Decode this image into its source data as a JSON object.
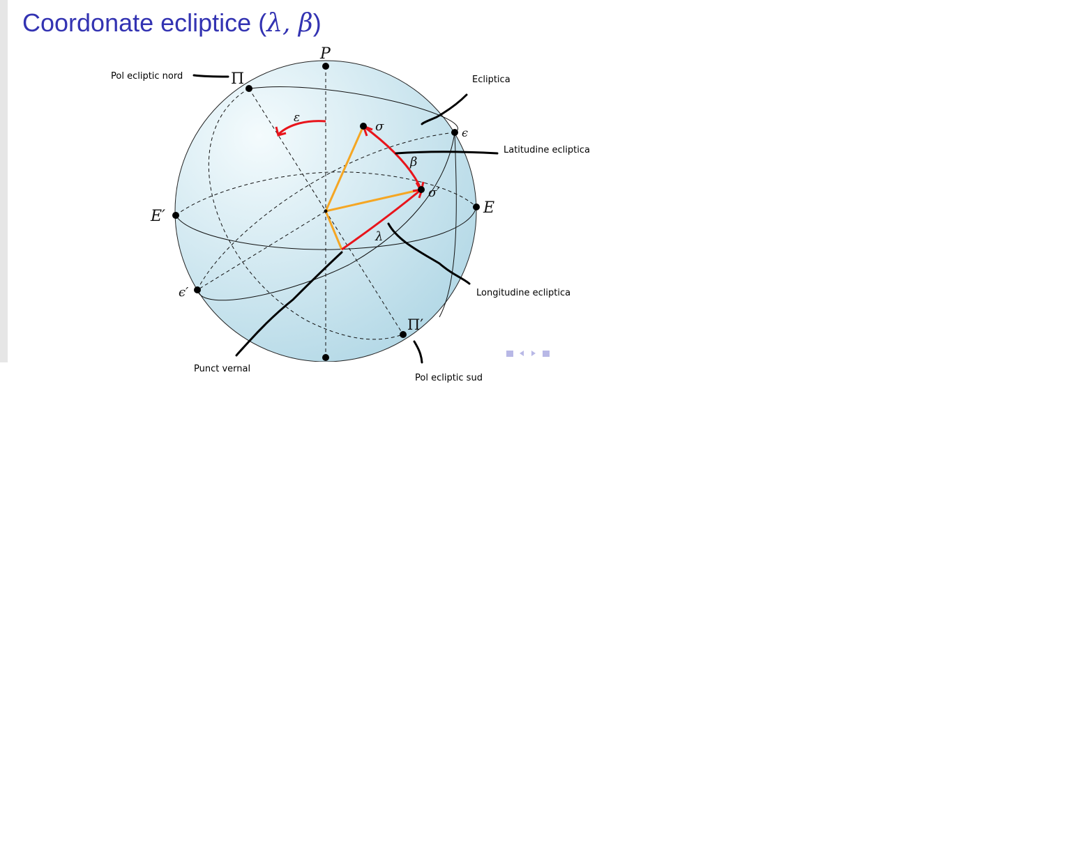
{
  "title": {
    "text": "Coordonate ecliptice (",
    "math": "λ, β",
    "close": ")"
  },
  "points": {
    "P": "P",
    "Pi": "Π",
    "Pi_prime": "Π′",
    "E": "E",
    "E_prime": "E′",
    "eps": "ϵ",
    "eps_prime": "ϵ′",
    "sigma": "σ",
    "sigma_prime": "σ′"
  },
  "angles": {
    "obliquity": "ε",
    "latitude": "β",
    "longitude": "λ"
  },
  "annotations": {
    "north_pole": "Pol ecliptic nord",
    "ecliptic": "Ecliptica",
    "latitude": "Latitudine ecliptica",
    "longitude": "Longitudine ecliptica",
    "vernal": "Punct vernal",
    "south_pole": "Pol ecliptic sud"
  },
  "colors": {
    "title": "#3333b2",
    "arc": "#e8141b",
    "radius": "#f5a623",
    "sphere_center": "#f4fbfd",
    "sphere_edge": "#b3d8e6"
  },
  "nav_icons": [
    "nav-frame-prev-icon",
    "nav-arrow-left-icon",
    "nav-arrow-right-icon",
    "nav-frame-next-icon"
  ]
}
